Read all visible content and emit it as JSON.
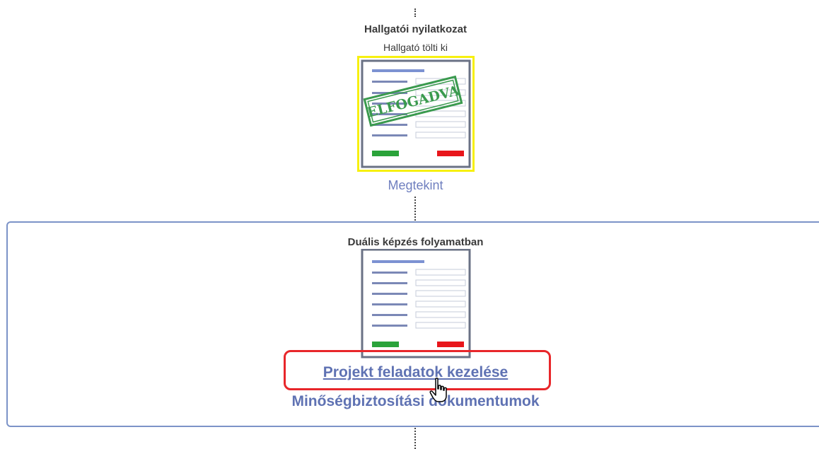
{
  "step1": {
    "title": "Hallgatói nyilatkozat",
    "subtitle": "Hallgató tölti ki",
    "stamp": "ELFOGADVA",
    "view_link": "Megtekint"
  },
  "step2": {
    "title": "Duális képzés folyamatban",
    "project_link": "Projekt feladatok kezelése",
    "quality_link": "Minőségbiztosítási dokumentumok"
  },
  "colors": {
    "link": "#5f72b3",
    "highlight": "#e8262a",
    "selection": "#f2ea00",
    "approve": "#2aa33a",
    "reject": "#e8161b",
    "stamp": "#3a9a4e"
  }
}
